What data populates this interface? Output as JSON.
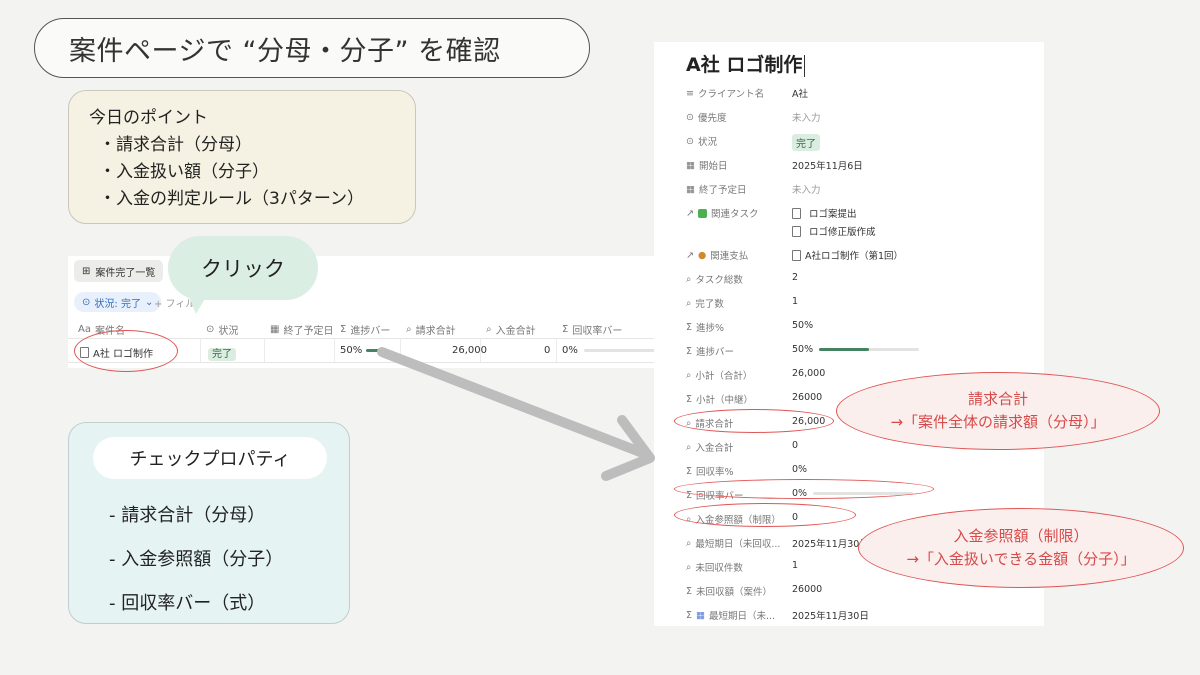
{
  "slide": {
    "title": "案件ページで “分母・分子” を確認",
    "points_heading": "今日のポイント",
    "points": [
      "・請求合計（分母）",
      "・入金扱い額（分子）",
      "・入金の判定ルール（3パターン）"
    ],
    "click_label": "クリック",
    "check_title": "チェックプロパティ",
    "check_items": [
      "- 請求合計（分母）",
      "- 入金参照額（分子）",
      "- 回収率バー（式）"
    ]
  },
  "table": {
    "view_tab": "案件完了一覧",
    "filter": "状況: 完了",
    "filter_add": "+ フィル",
    "columns": [
      "案件名",
      "状況",
      "終了予定日",
      "進捗バー",
      "請求合計",
      "入金合計",
      "回収率バー"
    ],
    "row": {
      "name": "A社 ロゴ制作",
      "status": "完了",
      "end_date": "",
      "progress": "50%",
      "progress_value": 0.5,
      "billing_total": "26,000",
      "payment_total": "0",
      "collection_rate": "0%"
    }
  },
  "panel": {
    "title": "A社 ロゴ制作",
    "properties": [
      {
        "label": "クライアント名",
        "value": "A社"
      },
      {
        "label": "優先度",
        "value": "未入力"
      },
      {
        "label": "状況",
        "value": "完了"
      },
      {
        "label": "開始日",
        "value": "2025年11月6日"
      },
      {
        "label": "終了予定日",
        "value": "未入力"
      },
      {
        "label": "関連タスク",
        "value": "ロゴ案提出",
        "value2": "ロゴ修正版作成"
      },
      {
        "label": "関連支払",
        "value": "A社ロゴ制作（第1回）"
      },
      {
        "label": "タスク総数",
        "value": "2"
      },
      {
        "label": "完了数",
        "value": "1"
      },
      {
        "label": "進捗%",
        "value": "50%"
      },
      {
        "label": "進捗バー",
        "value": "50%",
        "bar": 0.5
      },
      {
        "label": "小計（合計）",
        "value": "26,000"
      },
      {
        "label": "小計（中継）",
        "value": "26000"
      },
      {
        "label": "請求合計",
        "value": "26,000"
      },
      {
        "label": "入金合計",
        "value": "0"
      },
      {
        "label": "回収率%",
        "value": "0%"
      },
      {
        "label": "回収率バー",
        "value": "0%",
        "bar": 0
      },
      {
        "label": "入金参照額（制限）",
        "value": "0"
      },
      {
        "label": "最短期日（未回収...",
        "value": "2025年11月30日"
      },
      {
        "label": "未回収件数",
        "value": "1"
      },
      {
        "label": "未回収額（案件）",
        "value": "26000"
      },
      {
        "label": "最短期日（未...",
        "value": "2025年11月30日"
      }
    ]
  },
  "callouts": {
    "billing_title": "請求合計",
    "billing_desc": "→「案件全体の請求額（分母）」",
    "payment_title": "入金参照額（制限）",
    "payment_desc": "→「入金扱いできる金額（分子）」"
  },
  "colors": {
    "callout_red": "#e05555",
    "progress_green": "#448361",
    "done_badge_bg": "#dbede0"
  }
}
